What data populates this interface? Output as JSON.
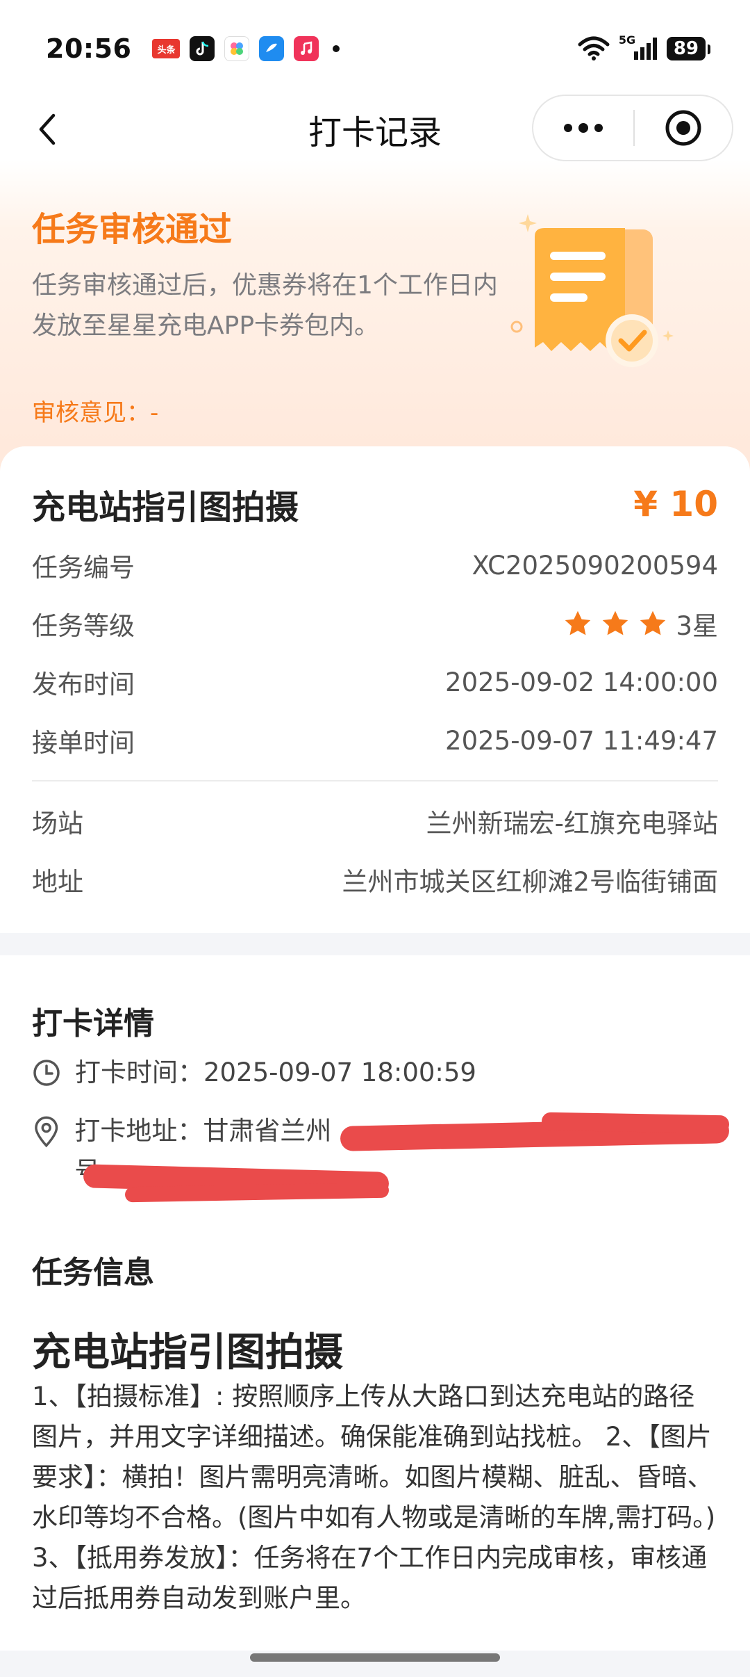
{
  "status_bar": {
    "time": "20:56",
    "network": "5G",
    "battery": "89"
  },
  "nav": {
    "title": "打卡记录"
  },
  "banner": {
    "title": "任务审核通过",
    "description": "任务审核通过后，优惠券将在1个工作日内发放至星星充电APP卡券包内。",
    "review_label": "审核意见：",
    "review_value": "-"
  },
  "task_card": {
    "title": "充电站指引图拍摄",
    "price": "¥ 10",
    "rows": [
      {
        "label": "任务编号",
        "value": "XC2025090200594"
      },
      {
        "label": "任务等级",
        "value": "3星"
      },
      {
        "label": "发布时间",
        "value": "2025-09-02 14:00:00"
      },
      {
        "label": "接单时间",
        "value": "2025-09-07 11:49:47"
      },
      {
        "label": "场站",
        "value": "兰州新瑞宏-红旗充电驿站"
      },
      {
        "label": "地址",
        "value": "兰州市城关区红柳滩2号临街铺面"
      }
    ],
    "stars": 3
  },
  "checkin": {
    "section_title": "打卡详情",
    "time_label": "打卡时间：",
    "time_value": "2025-09-07 18:00:59",
    "address_label": "打卡地址：",
    "address_value": "甘肃省兰州",
    "address_tail": "2",
    "address_line2": "号"
  },
  "task_info": {
    "section_title": "任务信息",
    "title": "充电站指引图拍摄",
    "description": "1、【拍摄标准】: 按照顺序上传从大路口到达充电站的路径图片，并用文字详细描述。确保能准确到站找桩。 2、【图片要求】：横拍！图片需明亮清晰。如图片模糊、脏乱、昏暗、水印等均不合格。(图片中如有人物或是清晰的车牌,需打码。) 3、【抵用券发放】：任务将在7个工作日内完成审核，审核通过后抵用券自动发到账户里。"
  },
  "colors": {
    "accent": "#f67a1a",
    "redaction": "#ea4b4b"
  }
}
